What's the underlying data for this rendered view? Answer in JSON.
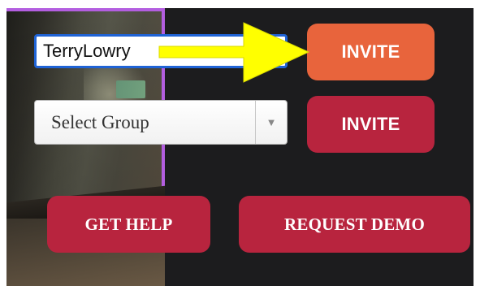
{
  "form": {
    "username_value": "TerryLowry",
    "username_placeholder": "",
    "group_select": {
      "selected_label": "Select Group",
      "arrow_glyph": "▼"
    }
  },
  "buttons": {
    "invite_primary_label": "INVITE",
    "invite_secondary_label": "INVITE",
    "get_help_label": "GET HELP",
    "request_demo_label": "REQUEST DEMO"
  },
  "colors": {
    "background": "#1c1c1e",
    "video_border": "#b35ee0",
    "input_focus_border": "#1f63d6",
    "invite_primary": "#e8643c",
    "button_red": "#b8243e",
    "annotation_arrow": "#ffff00"
  },
  "annotation": {
    "icon": "arrow-right-icon"
  }
}
